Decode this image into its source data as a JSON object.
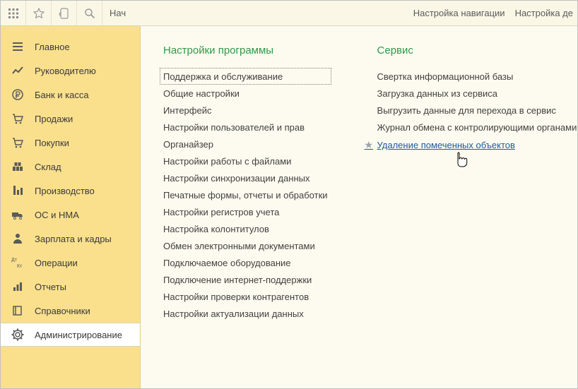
{
  "topbar": {
    "title_truncated": "Нач",
    "right_links": {
      "nav_settings": "Настройка навигации",
      "action_settings_truncated": "Настройка де"
    }
  },
  "sidebar": {
    "items": [
      {
        "label": "Главное",
        "icon": "menu-icon"
      },
      {
        "label": "Руководителю",
        "icon": "chart-line-icon"
      },
      {
        "label": "Банк и касса",
        "icon": "ruble-circle-icon"
      },
      {
        "label": "Продажи",
        "icon": "cart-icon"
      },
      {
        "label": "Покупки",
        "icon": "cart-in-icon"
      },
      {
        "label": "Склад",
        "icon": "warehouse-icon"
      },
      {
        "label": "Производство",
        "icon": "factory-icon"
      },
      {
        "label": "ОС и НМА",
        "icon": "truck-icon"
      },
      {
        "label": "Зарплата и кадры",
        "icon": "person-icon"
      },
      {
        "label": "Операции",
        "icon": "operations-icon"
      },
      {
        "label": "Отчеты",
        "icon": "reports-icon"
      },
      {
        "label": "Справочники",
        "icon": "book-icon"
      },
      {
        "label": "Администрирование",
        "icon": "gear-icon",
        "active": true
      }
    ]
  },
  "content": {
    "col1": {
      "title": "Настройки программы",
      "links": [
        {
          "label": "Поддержка и обслуживание",
          "selected": true
        },
        {
          "label": "Общие настройки"
        },
        {
          "label": "Интерфейс"
        },
        {
          "label": "Настройки пользователей и прав"
        },
        {
          "label": "Органайзер"
        },
        {
          "label": "Настройки работы с файлами"
        },
        {
          "label": "Настройки синхронизации данных"
        },
        {
          "label": "Печатные формы, отчеты и обработки"
        },
        {
          "label": "Настройки регистров учета"
        },
        {
          "label": "Настройка колонтитулов"
        },
        {
          "label": "Обмен электронными документами"
        },
        {
          "label": "Подключаемое оборудование"
        },
        {
          "label": "Подключение интернет-поддержки"
        },
        {
          "label": "Настройки проверки контрагентов"
        },
        {
          "label": "Настройки актуализации данных"
        }
      ]
    },
    "col2": {
      "title": "Сервис",
      "links": [
        {
          "label": "Свертка информационной базы"
        },
        {
          "label": "Загрузка данных из сервиса"
        },
        {
          "label": "Выгрузить данные для перехода в сервис"
        },
        {
          "label": "Журнал обмена с контролирующими органами"
        },
        {
          "label": "Удаление помеченных объектов",
          "starred": true,
          "hover": true
        }
      ]
    }
  }
}
